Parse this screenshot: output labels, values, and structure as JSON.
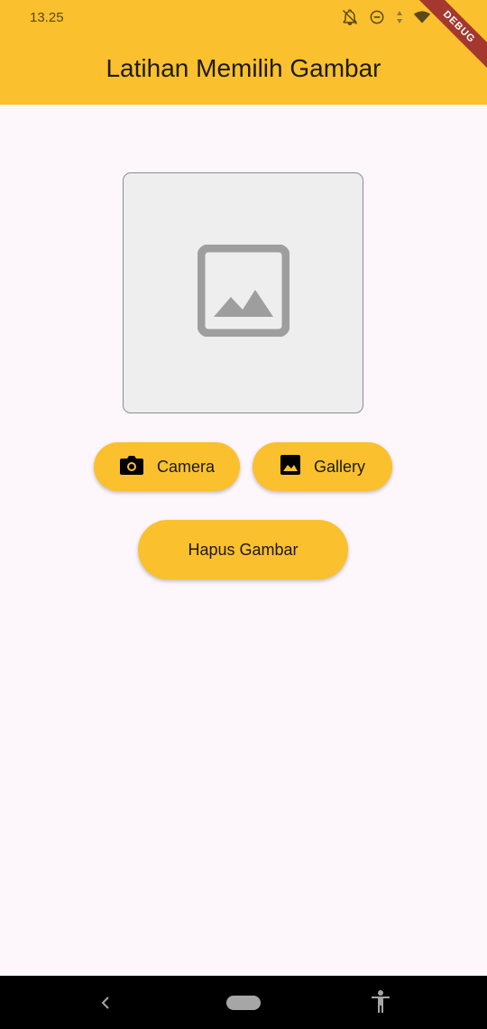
{
  "status_bar": {
    "time": "13.25"
  },
  "app_bar": {
    "title": "Latihan Memilih Gambar",
    "debug_label": "DEBUG"
  },
  "image_preview": {
    "icon": "image-placeholder-icon"
  },
  "buttons": {
    "camera_label": "Camera",
    "gallery_label": "Gallery",
    "hapus_label": "Hapus Gambar"
  },
  "colors": {
    "accent": "#fbc02d",
    "background": "#fdf7fc",
    "debug_banner": "#a4382e"
  }
}
